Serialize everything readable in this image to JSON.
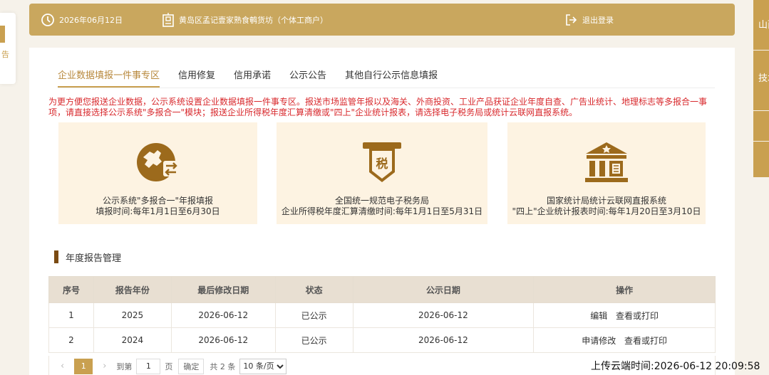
{
  "left_float": {
    "text": "告"
  },
  "right_tabs": [
    "山西",
    "技术",
    "",
    ""
  ],
  "header": {
    "date": "2026年06月12日",
    "company": "黄岛区孟记壹家熟食鹌货坊（个体工商户）",
    "logout": "退出登录"
  },
  "tabs": [
    "企业数据填报一件事专区",
    "信用修复",
    "信用承诺",
    "公示公告",
    "其他自行公示信息填报"
  ],
  "notice": "为更方便您报送企业数据，公示系统设置企业数据填报一件事专区。报送市场监管年报以及海关、外商投资、工业产品获证企业年度自查、广告业统计、地理标志等多报合一事项，请直接选择公示系统\"多报合一\"模块；报送企业所得税年度汇算清缴或\"四上\"企业统计报表，请选择电子税务局或统计云联网直报系统。",
  "services": [
    {
      "icon": "map-transfer-icon",
      "line1": "公示系统\"多报合一\"年报填报",
      "line2": "填报时间:每年1月1日至6月30日"
    },
    {
      "icon": "tax-icon",
      "line1": "全国统一规范电子税务局",
      "line2": "企业所得税年度汇算清缴时间:每年1月1日至5月31日"
    },
    {
      "icon": "bank-icon",
      "line1": "国家统计局统计云联网直报系统",
      "line2": "\"四上\"企业统计报表时间:每年1月20日至3月10日"
    }
  ],
  "section_title": "年度报告管理",
  "table": {
    "headers": [
      "序号",
      "报告年份",
      "最后修改日期",
      "状态",
      "公示日期",
      "操作"
    ],
    "rows": [
      {
        "no": "1",
        "year": "2025",
        "modified": "2026-06-12",
        "status": "已公示",
        "published": "2026-06-12",
        "op1": "编辑",
        "op2": "查看或打印"
      },
      {
        "no": "2",
        "year": "2024",
        "modified": "2026-06-12",
        "status": "已公示",
        "published": "2026-06-12",
        "op1": "申请修改",
        "op2": "查看或打印"
      }
    ]
  },
  "pager": {
    "prev": "‹",
    "current": "1",
    "next": "›",
    "goto_label": "到第",
    "page_value": "1",
    "page_unit": "页",
    "confirm": "确定",
    "total": "共 2 条",
    "page_size": "10 条/页"
  },
  "upload_time": "上传云端时间:2026-06-12 20:09:58",
  "colors": {
    "accent": "#c9a75e",
    "notice": "#d8282c",
    "card_bg": "#fdf3e2"
  }
}
